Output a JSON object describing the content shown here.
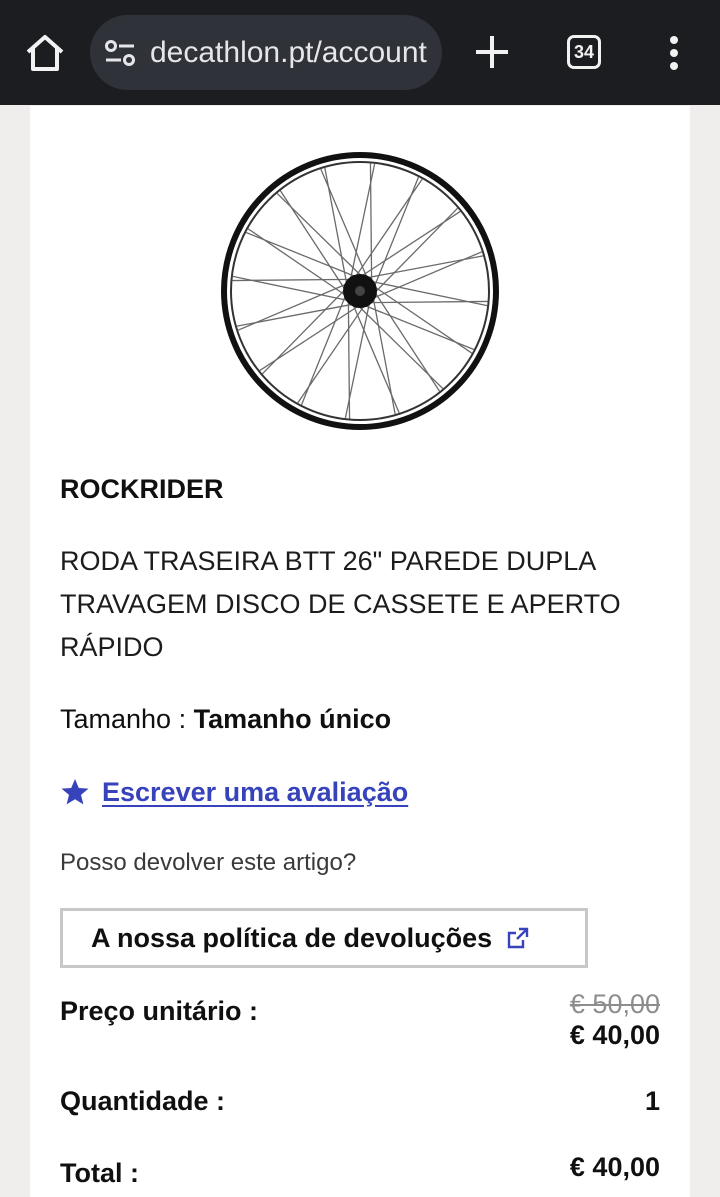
{
  "browser": {
    "url": "decathlon.pt/account",
    "tab_count": "34"
  },
  "product": {
    "brand": "ROCKRIDER",
    "title": "RODA TRASEIRA BTT 26\" PAREDE DUPLA TRAVAGEM DISCO DE CASSETE E APERTO RÁPIDO",
    "size_label": "Tamanho : ",
    "size_value": "Tamanho único",
    "review_link": "Escrever uma avaliação",
    "return_question": "Posso devolver este artigo?",
    "return_policy_button": "A nossa política de devoluções"
  },
  "pricing": {
    "unit_price_label": "Preço unitário :",
    "original_price": "€ 50,00",
    "unit_price": "€ 40,00",
    "quantity_label": "Quantidade :",
    "quantity": "1",
    "total_label": "Total :",
    "total": "€ 40,00"
  },
  "colors": {
    "link": "#3643ba",
    "browser_bar": "#1c1d21"
  },
  "icons": [
    "home-icon",
    "site-settings-icon",
    "plus-icon",
    "tab-switcher-icon",
    "more-vert-icon",
    "star-icon",
    "external-link-icon"
  ]
}
